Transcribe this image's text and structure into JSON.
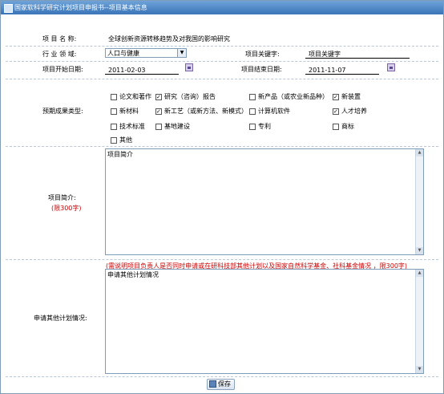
{
  "window": {
    "title": "国家软科学研究计划项目申报书--项目基本信息"
  },
  "form": {
    "project_name_label": "项 目 名 称:",
    "project_name_value": "全球创新资源转移趋势及对我国的影响研究",
    "industry_label": "行 业 领 域:",
    "industry_value": "人口与健康",
    "keyword_label": "项目关键字:",
    "keyword_value": "项目关键字",
    "start_label": "项目开始日期:",
    "start_value": "2011-02-03",
    "end_label": "项目结束日期:",
    "end_value": "2011-11-07",
    "outcome_label": "预期成果类型:",
    "outcomes": [
      {
        "label": "论文和著作",
        "checked": false
      },
      {
        "label": "研究（咨询）报告",
        "checked": true
      },
      {
        "label": "新产品（或农业新品种）",
        "checked": false
      },
      {
        "label": "新装置",
        "checked": true
      },
      {
        "label": "新材料",
        "checked": false
      },
      {
        "label": "新工艺（或新方法、新模式）",
        "checked": true
      },
      {
        "label": "计算机软件",
        "checked": false
      },
      {
        "label": "人才培养",
        "checked": true
      },
      {
        "label": "技术标准",
        "checked": false
      },
      {
        "label": "基地建设",
        "checked": false
      },
      {
        "label": "专利",
        "checked": false
      },
      {
        "label": "商标",
        "checked": false
      },
      {
        "label": "其他",
        "checked": false
      }
    ],
    "intro_label": "项目简介:",
    "intro_limit": "(限300字)",
    "intro_value": "项目简介",
    "other_note": "(需说明项目负责人是否同时申请或在研科技部其他计划以及国家自然科学基金、社科基金情况 ，限300字)",
    "other_label": "申请其他计划情况:",
    "other_value": "申请其他计划情况",
    "save_label": "保存"
  }
}
